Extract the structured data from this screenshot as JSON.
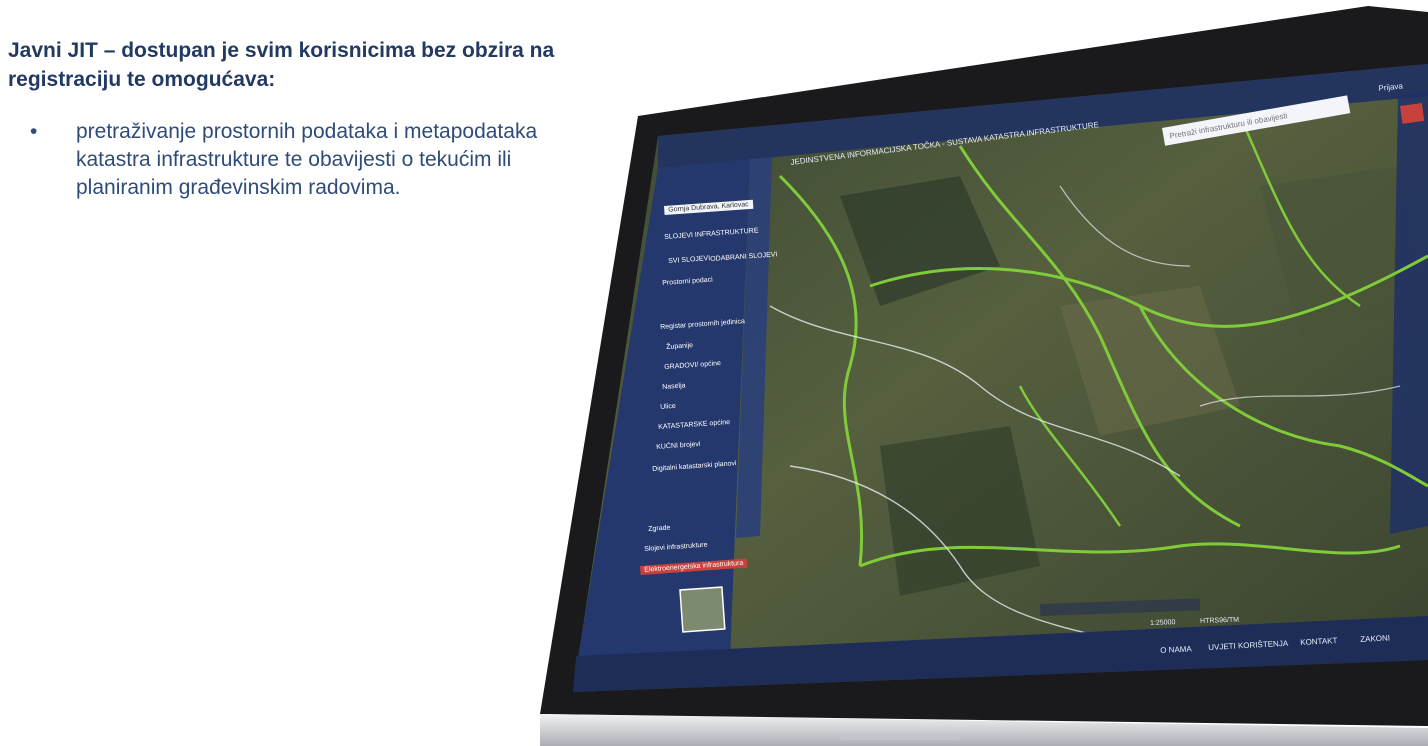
{
  "text": {
    "heading": "Javni JIT – dostupan je svim korisnicima bez obzira na registraciju te omogućava:",
    "bullets": [
      "pretraživanje prostornih podataka i metapodataka katastra infrastrukture te obavijesti o tekućim ili planiranim građevinskim radovima."
    ],
    "bullet_symbol": "•"
  },
  "screen": {
    "login": "Prijava",
    "app_title": "JEDINSTVENA INFORMACIJSKA TOČKA - SUSTAVA KATASTRA INFRASTRUKTURE",
    "search_placeholder": "Pretraži infrastrukturu ili obavijesti",
    "location_field": "Gornja Dubrava, Karlovac",
    "panel_title": "SLOJEVI INFRASTRUKTURE",
    "tabs": [
      "SVI SLOJEVI",
      "ODABRANI SLOJEVI"
    ],
    "layers": [
      "Prostorni podaci",
      "Registar prostornih jedinica",
      "Županije",
      "GRADOVI/ općine",
      "Naselja",
      "Ulice",
      "KATASTARSKE općine",
      "KUĆNI brojevi",
      "Digitalni katastarski planovi",
      "Zgrade",
      "Slojevi infrastrukture",
      "Elektroenergetska infrastruktura"
    ],
    "footer_links": [
      "O NAMA",
      "UVJETI KORIŠTENJA",
      "KONTAKT",
      "ZAKONI"
    ],
    "scale": "1:25000",
    "projection": "HTRS96/TM"
  },
  "colors": {
    "heading": "#223a63",
    "body_text": "#2f4c79",
    "map_green": "#7fcb3a",
    "panel_blue": "#2d4a8f",
    "accent_red": "#c9413c"
  }
}
